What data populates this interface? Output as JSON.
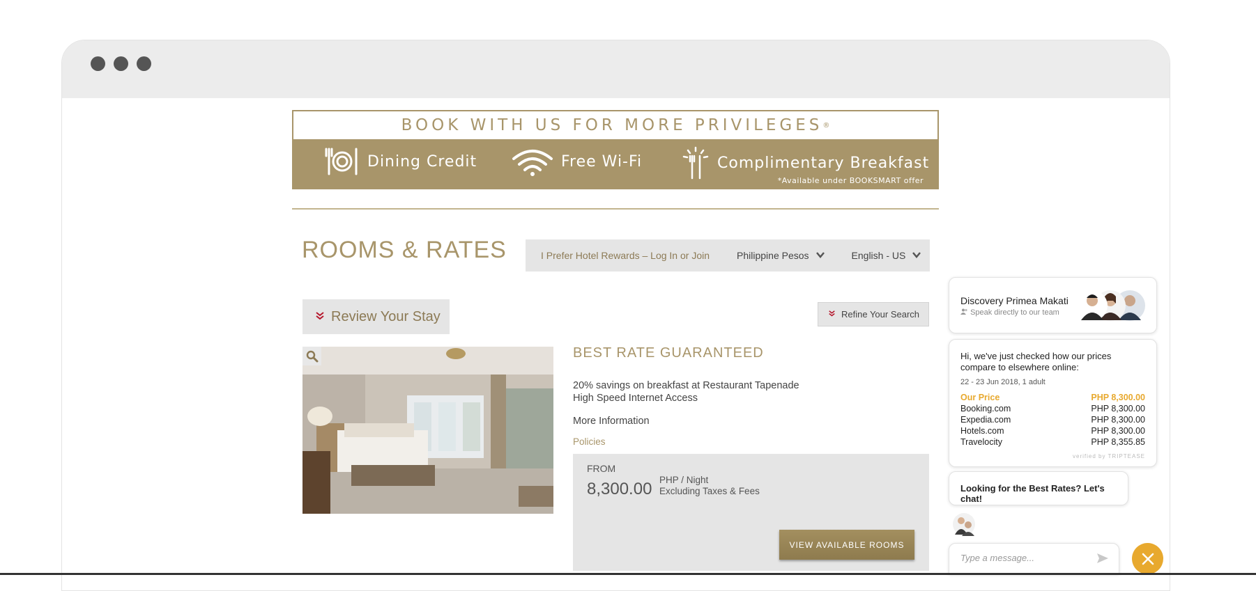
{
  "banner": {
    "headline": "BOOK WITH US FOR MORE PRIVILEGES",
    "headline_mark": "®",
    "perks": [
      "Dining Credit",
      "Free Wi-Fi",
      "Complimentary Breakfast"
    ],
    "note": "*Available under BOOKSMART offer"
  },
  "header": {
    "title": "ROOMS & RATES",
    "rewards_link": "I Prefer Hotel Rewards – Log In or Join",
    "currency": "Philippine Pesos",
    "language": "English - US"
  },
  "actions": {
    "review_label": "Review Your Stay",
    "refine_label": "Refine Your Search"
  },
  "rate": {
    "title": "BEST RATE GUARANTEED",
    "features": [
      "20% savings on breakfast at Restaurant Tapenade",
      "High Speed Internet Access"
    ],
    "more_info": "More Information",
    "policies": "Policies",
    "from_label": "FROM",
    "amount": "8,300.00",
    "unit": "PHP / Night",
    "tax_note": "Excluding Taxes & Fees",
    "button": "VIEW AVAILABLE ROOMS"
  },
  "chat": {
    "hotel_name": "Discovery Primea Makati",
    "subtitle": "Speak directly to our team",
    "compare_intro": "Hi, we've just checked how our prices compare to elsewhere online:",
    "compare_dates": "22 - 23 Jun 2018, 1 adult",
    "rows": [
      {
        "site": "Our Price",
        "price": "PHP 8,300.00"
      },
      {
        "site": "Booking.com",
        "price": "PHP 8,300.00"
      },
      {
        "site": "Expedia.com",
        "price": "PHP 8,300.00"
      },
      {
        "site": "Hotels.com",
        "price": "PHP 8,300.00"
      },
      {
        "site": "Travelocity",
        "price": "PHP 8,355.85"
      }
    ],
    "verified": "verified by TRIPTEASE",
    "prompt": "Looking for the Best Rates? Let's chat!",
    "input_placeholder": "Type a message...",
    "accent_color": "#e8a92e"
  },
  "colors": {
    "brand_gold": "#a8956a",
    "chevron_red": "#b5152b"
  }
}
